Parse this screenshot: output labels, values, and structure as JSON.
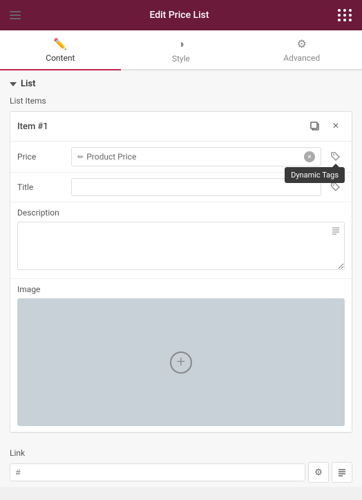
{
  "header": {
    "title": "Edit Price List",
    "menu_icon": "menu-icon",
    "grid_icon": "apps-icon"
  },
  "tabs": [
    {
      "id": "content",
      "label": "Content",
      "icon": "pencil",
      "active": true
    },
    {
      "id": "style",
      "label": "Style",
      "icon": "circle-half",
      "active": false
    },
    {
      "id": "advanced",
      "label": "Advanced",
      "icon": "gear",
      "active": false
    }
  ],
  "section": {
    "title": "List"
  },
  "list_items_label": "List Items",
  "item": {
    "title": "Item #1",
    "price_label": "Price",
    "price_value": "Product Price",
    "price_icon": "tag-icon",
    "title_label": "Title",
    "title_placeholder": "",
    "description_label": "Description",
    "image_label": "Image",
    "link_label": "Link",
    "link_placeholder": "#"
  },
  "tooltip": {
    "text": "Dynamic Tags"
  },
  "icons": {
    "copy": "copy-icon",
    "close": "×",
    "tag": "🏷",
    "gear": "⚙",
    "list": "≡"
  }
}
